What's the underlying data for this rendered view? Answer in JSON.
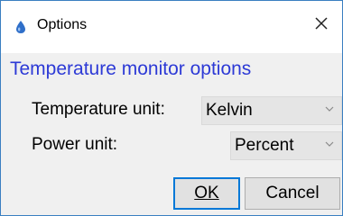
{
  "window": {
    "title": "Options"
  },
  "dialog": {
    "heading": "Temperature monitor options",
    "temperature_unit": {
      "label": "Temperature unit:",
      "value": "Kelvin"
    },
    "power_unit": {
      "label": "Power unit:",
      "value": "Percent"
    },
    "buttons": {
      "ok": "OK",
      "cancel": "Cancel"
    }
  },
  "icons": {
    "app": "thermometer-drop-icon",
    "close": "close-icon",
    "dropdown": "chevron-down-icon"
  },
  "colors": {
    "heading": "#2d3ad6",
    "accent": "#0078d7",
    "content_bg": "#f0f0f0"
  }
}
